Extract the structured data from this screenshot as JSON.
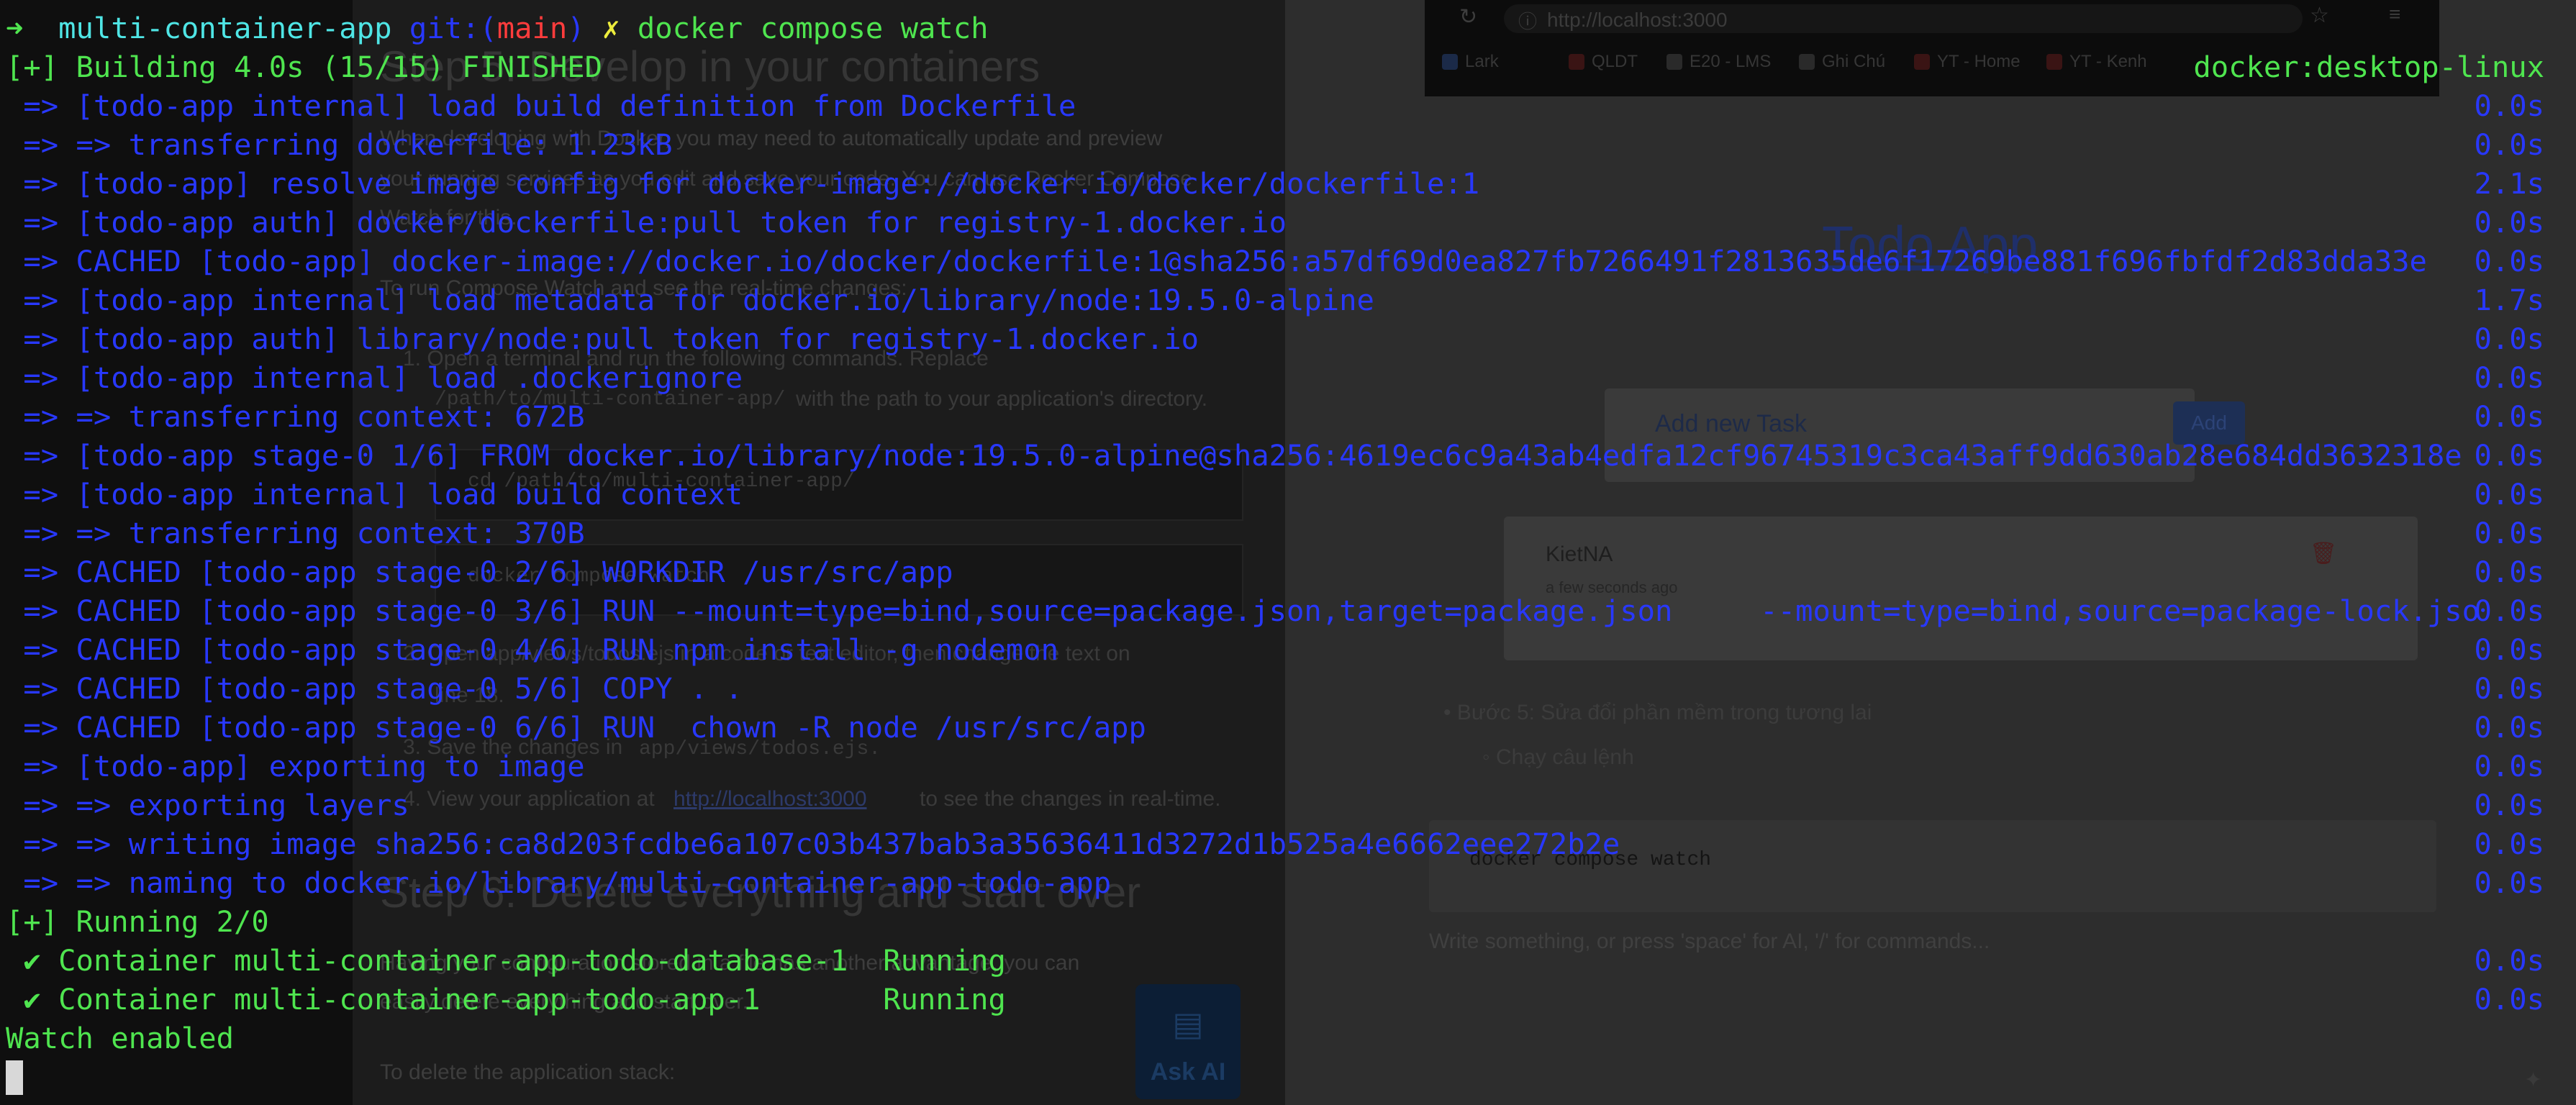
{
  "docs": {
    "heading_develop": "Step 5: Develop in your containers",
    "intro_line1": "When developing with Docker, you may need to automatically update and preview",
    "intro_line2": "your running services as you edit and save your code. You can use Docker Compose",
    "intro_line3": "Watch for this.",
    "run_watch": "To run Compose Watch and see the real-time changes:",
    "step1_line1": "1. Open a terminal and run the following commands. Replace",
    "step1_path": "/path/to/multi-container-app/",
    "step1_line2": "with the path to your application's directory.",
    "code_cd": "cd /path/to/multi-container-app/",
    "code_watch": "docker compose watch",
    "step2_line1": "2. Open app/views/todos.ejs in a code or text editor, then change the text on",
    "step2_line2": "line 18.",
    "step3": "3. Save the changes in",
    "step3_file": "app/views/todos.ejs.",
    "step4_pre": "4. View your application at",
    "step4_link": "http://localhost:3000",
    "step4_post": "to see the changes in real-time.",
    "heading_delete": "Step 6: Delete everything and start over",
    "delete_line1": "Having your configuration stored in a file has another advantage, you can",
    "delete_line2": "easily delete everything and start over.",
    "delete_stack": "To delete the application stack:",
    "ask_ai": "Ask AI"
  },
  "browser": {
    "url": "http://localhost:3000",
    "bookmarks": [
      "Lark",
      "QLDT",
      "E20 - LMS",
      "Ghi Chú",
      "YT - Home",
      "YT - Kenh"
    ],
    "app_title": "Todo App",
    "input_placeholder": "Add new Task",
    "add_button": "Add",
    "task_name": "KietNA",
    "task_time": "a few seconds ago"
  },
  "notes": {
    "bullet_step5": "Bước 5: Sửa đổi phần mềm trong tương lai",
    "sub_bullet": "Chạy câu lệnh",
    "code": "docker compose watch",
    "placeholder": "Write something, or press 'space' for AI, '/' for commands..."
  },
  "terminal": {
    "prompt_arrow": "➜",
    "dir": "multi-container-app",
    "git_label": "git:(",
    "branch": "main",
    "git_close": ")",
    "dirty_mark": "✗",
    "command": "docker compose watch",
    "context": "docker:desktop-linux",
    "build_header": "[+] Building 4.0s (15/15) FINISHED",
    "build_lines": [
      {
        "text": " => [todo-app internal] load build definition from Dockerfile",
        "dur": "0.0s"
      },
      {
        "text": " => => transferring dockerfile: 1.23kB",
        "dur": "0.0s"
      },
      {
        "text": " => [todo-app] resolve image config for docker-image://docker.io/docker/dockerfile:1",
        "dur": "2.1s"
      },
      {
        "text": " => [todo-app auth] docker/dockerfile:pull token for registry-1.docker.io",
        "dur": "0.0s"
      },
      {
        "text": " => CACHED [todo-app] docker-image://docker.io/docker/dockerfile:1@sha256:a57df69d0ea827fb7266491f2813635de6f17269be881f696fbfdf2d83dda33e",
        "dur": "0.0s"
      },
      {
        "text": " => [todo-app internal] load metadata for docker.io/library/node:19.5.0-alpine",
        "dur": "1.7s"
      },
      {
        "text": " => [todo-app auth] library/node:pull token for registry-1.docker.io",
        "dur": "0.0s"
      },
      {
        "text": " => [todo-app internal] load .dockerignore",
        "dur": "0.0s"
      },
      {
        "text": " => => transferring context: 672B",
        "dur": "0.0s"
      },
      {
        "text": " => [todo-app stage-0 1/6] FROM docker.io/library/node:19.5.0-alpine@sha256:4619ec6c9a43ab4edfa12cf96745319c3ca43aff9dd630ab28e684dd3632318e",
        "dur": "0.0s"
      },
      {
        "text": " => [todo-app internal] load build context",
        "dur": "0.0s"
      },
      {
        "text": " => => transferring context: 370B",
        "dur": "0.0s"
      },
      {
        "text": " => CACHED [todo-app stage-0 2/6] WORKDIR /usr/src/app",
        "dur": "0.0s"
      },
      {
        "text": " => CACHED [todo-app stage-0 3/6] RUN --mount=type=bind,source=package.json,target=package.json     --mount=type=bind,source=package-lock.jso",
        "dur": "0.0s"
      },
      {
        "text": " => CACHED [todo-app stage-0 4/6] RUN npm install -g nodemon",
        "dur": "0.0s"
      },
      {
        "text": " => CACHED [todo-app stage-0 5/6] COPY . .",
        "dur": "0.0s"
      },
      {
        "text": " => CACHED [todo-app stage-0 6/6] RUN  chown -R node /usr/src/app",
        "dur": "0.0s"
      },
      {
        "text": " => [todo-app] exporting to image",
        "dur": "0.0s"
      },
      {
        "text": " => => exporting layers",
        "dur": "0.0s"
      },
      {
        "text": " => => writing image sha256:ca8d203fcdbe6a107c03b437bab3a35636411d3272d1b525a4e6662eee272b2e",
        "dur": "0.0s"
      },
      {
        "text": " => => naming to docker.io/library/multi-container-app-todo-app",
        "dur": "0.0s"
      }
    ],
    "running_header": "[+] Running 2/0",
    "containers": [
      {
        "check": "✔",
        "name": "Container multi-container-app-todo-database-1",
        "status": "Running",
        "dur": "0.0s"
      },
      {
        "check": "✔",
        "name": "Container multi-container-app-todo-app-1",
        "status": "Running",
        "dur": "0.0s"
      }
    ],
    "watch_enabled": "Watch enabled"
  }
}
